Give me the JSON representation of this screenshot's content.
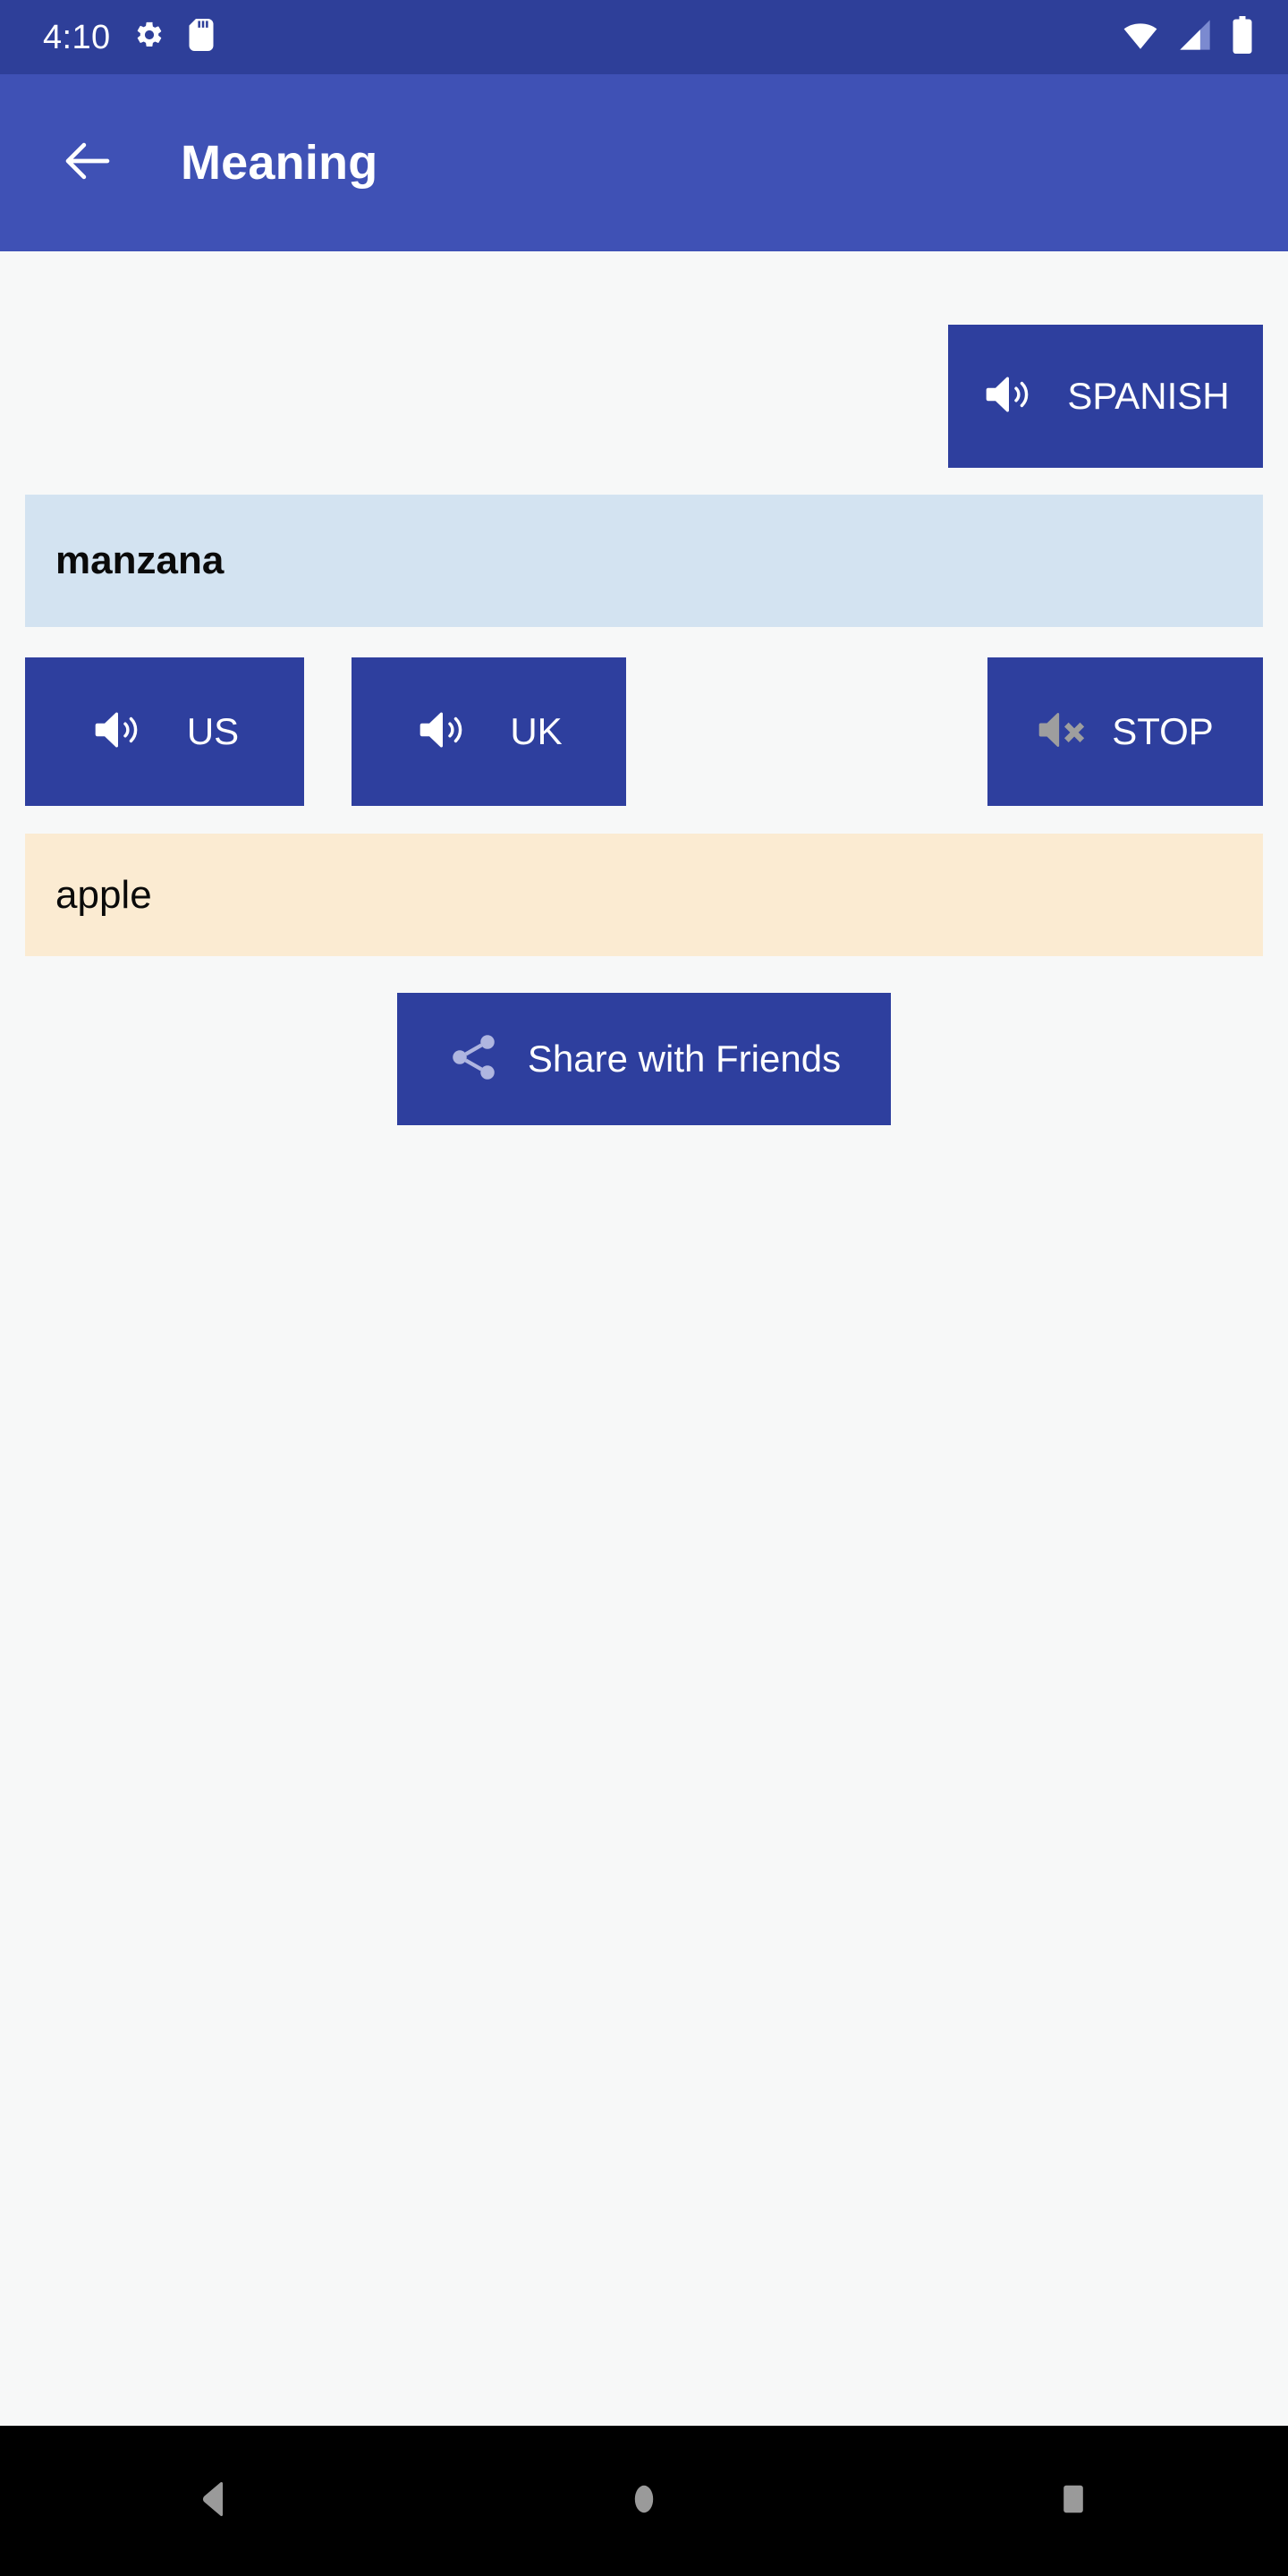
{
  "status_bar": {
    "time": "4:10",
    "left_icons": [
      "settings-gear-icon",
      "sd-card-icon"
    ],
    "right_icons": [
      "wifi-icon",
      "cellular-signal-icon",
      "battery-icon"
    ],
    "background_color": "#2E3F99"
  },
  "app_bar": {
    "back_icon": "back-arrow-icon",
    "title": "Meaning",
    "background_color": "#3F51B5"
  },
  "main": {
    "language_button": {
      "label": "SPANISH",
      "icon": "speaker-on-icon"
    },
    "source_word": {
      "text": "manzana",
      "background_color": "#D3E3F1"
    },
    "accent_buttons": [
      {
        "label": "US",
        "icon": "speaker-on-icon"
      },
      {
        "label": "UK",
        "icon": "speaker-on-icon"
      }
    ],
    "stop_button": {
      "label": "STOP",
      "icon": "speaker-muted-icon",
      "icon_color": "#9E9E9E"
    },
    "target_word": {
      "text": "apple",
      "background_color": "#FBEBD2"
    },
    "share_button": {
      "label": "Share with Friends",
      "icon": "share-nodes-icon",
      "icon_color": "#AFB6E0"
    },
    "button_color": "#2E3F9E",
    "background_color": "#F7F8F8"
  },
  "nav_bar": {
    "buttons": [
      "back-triangle-icon",
      "home-circle-icon",
      "recents-square-icon"
    ],
    "background_color": "#000000",
    "icon_color": "#9A9A9A"
  }
}
